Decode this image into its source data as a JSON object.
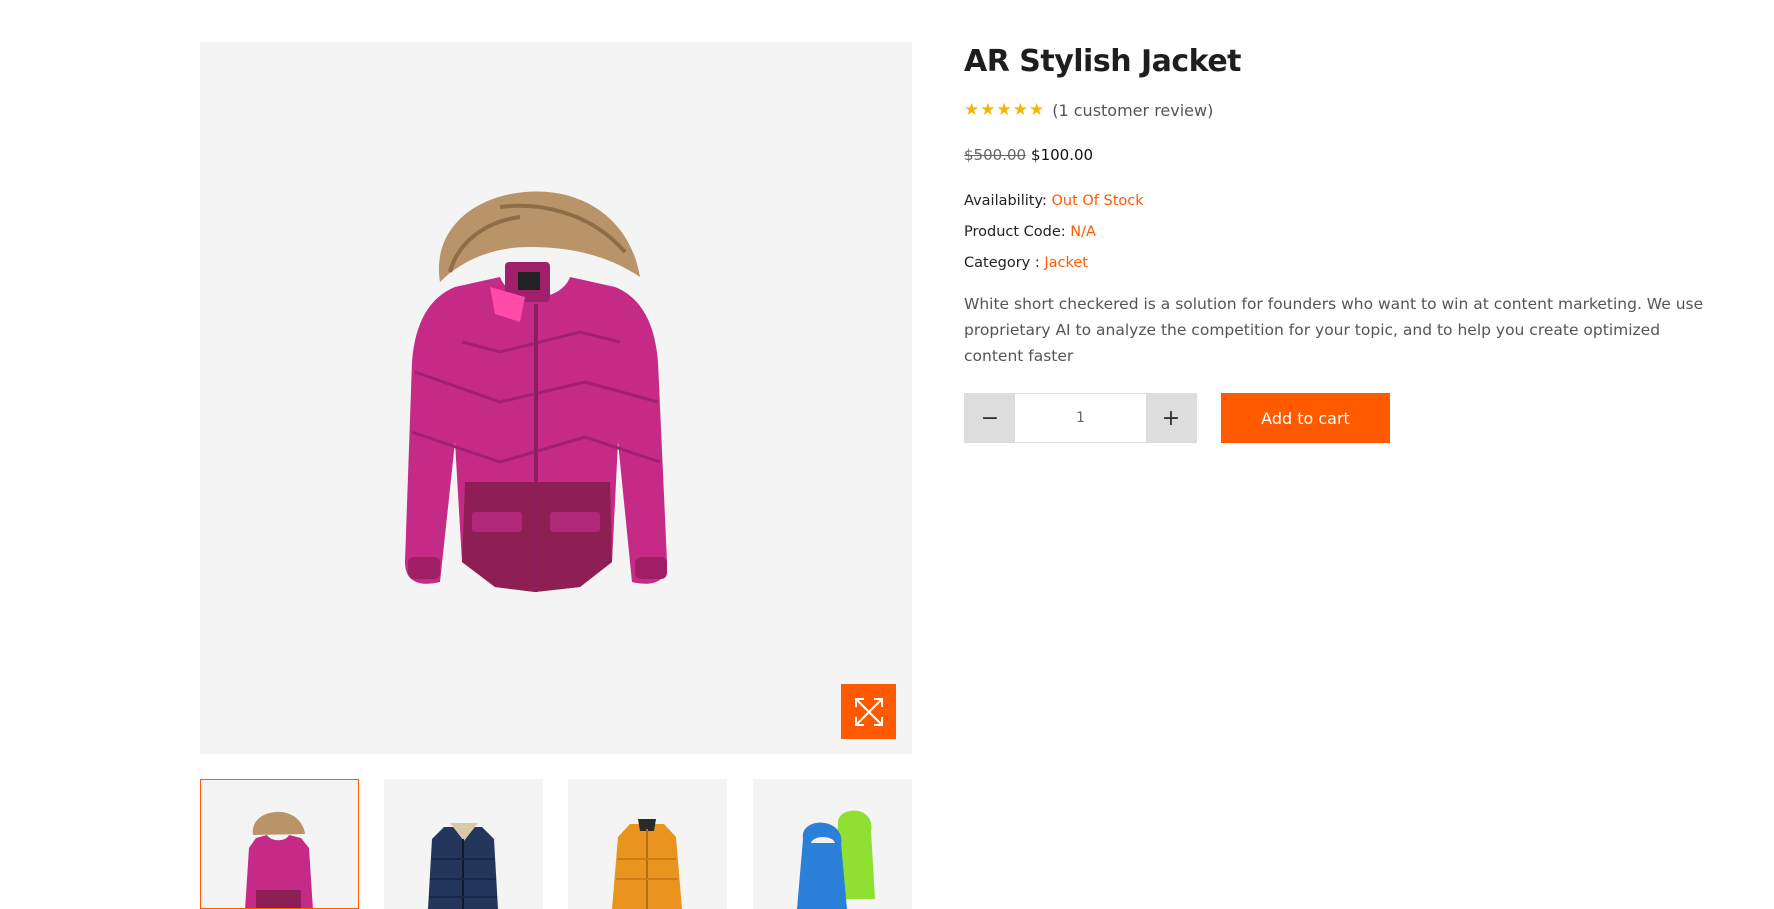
{
  "product": {
    "title": "AR Stylish Jacket",
    "rating": 5,
    "review_text": "(1 customer review)",
    "price_old": "$500.00",
    "price_new": "$100.00",
    "availability_label": "Availability:",
    "availability_value": "Out Of Stock",
    "code_label": "Product Code:",
    "code_value": "N/A",
    "category_label": "Category :",
    "category_value": "Jacket",
    "description": "White short checkered is a solution for founders who want to win at content marketing. We use proprietary AI to analyze the competition for your topic, and to help you create optimized content faster"
  },
  "cart": {
    "quantity": "1",
    "decrement_symbol": "−",
    "increment_symbol": "+",
    "add_label": "Add to cart"
  },
  "gallery": {
    "main_image": "pink-jacket",
    "thumbnails": [
      "pink-jacket",
      "navy-jacket",
      "orange-jacket",
      "blue-green-jackets"
    ],
    "active_index": 0
  },
  "colors": {
    "accent": "#ff5a00",
    "star": "#f5b400"
  },
  "icons": {
    "zoom": "expand-arrows-icon",
    "star": "★"
  }
}
